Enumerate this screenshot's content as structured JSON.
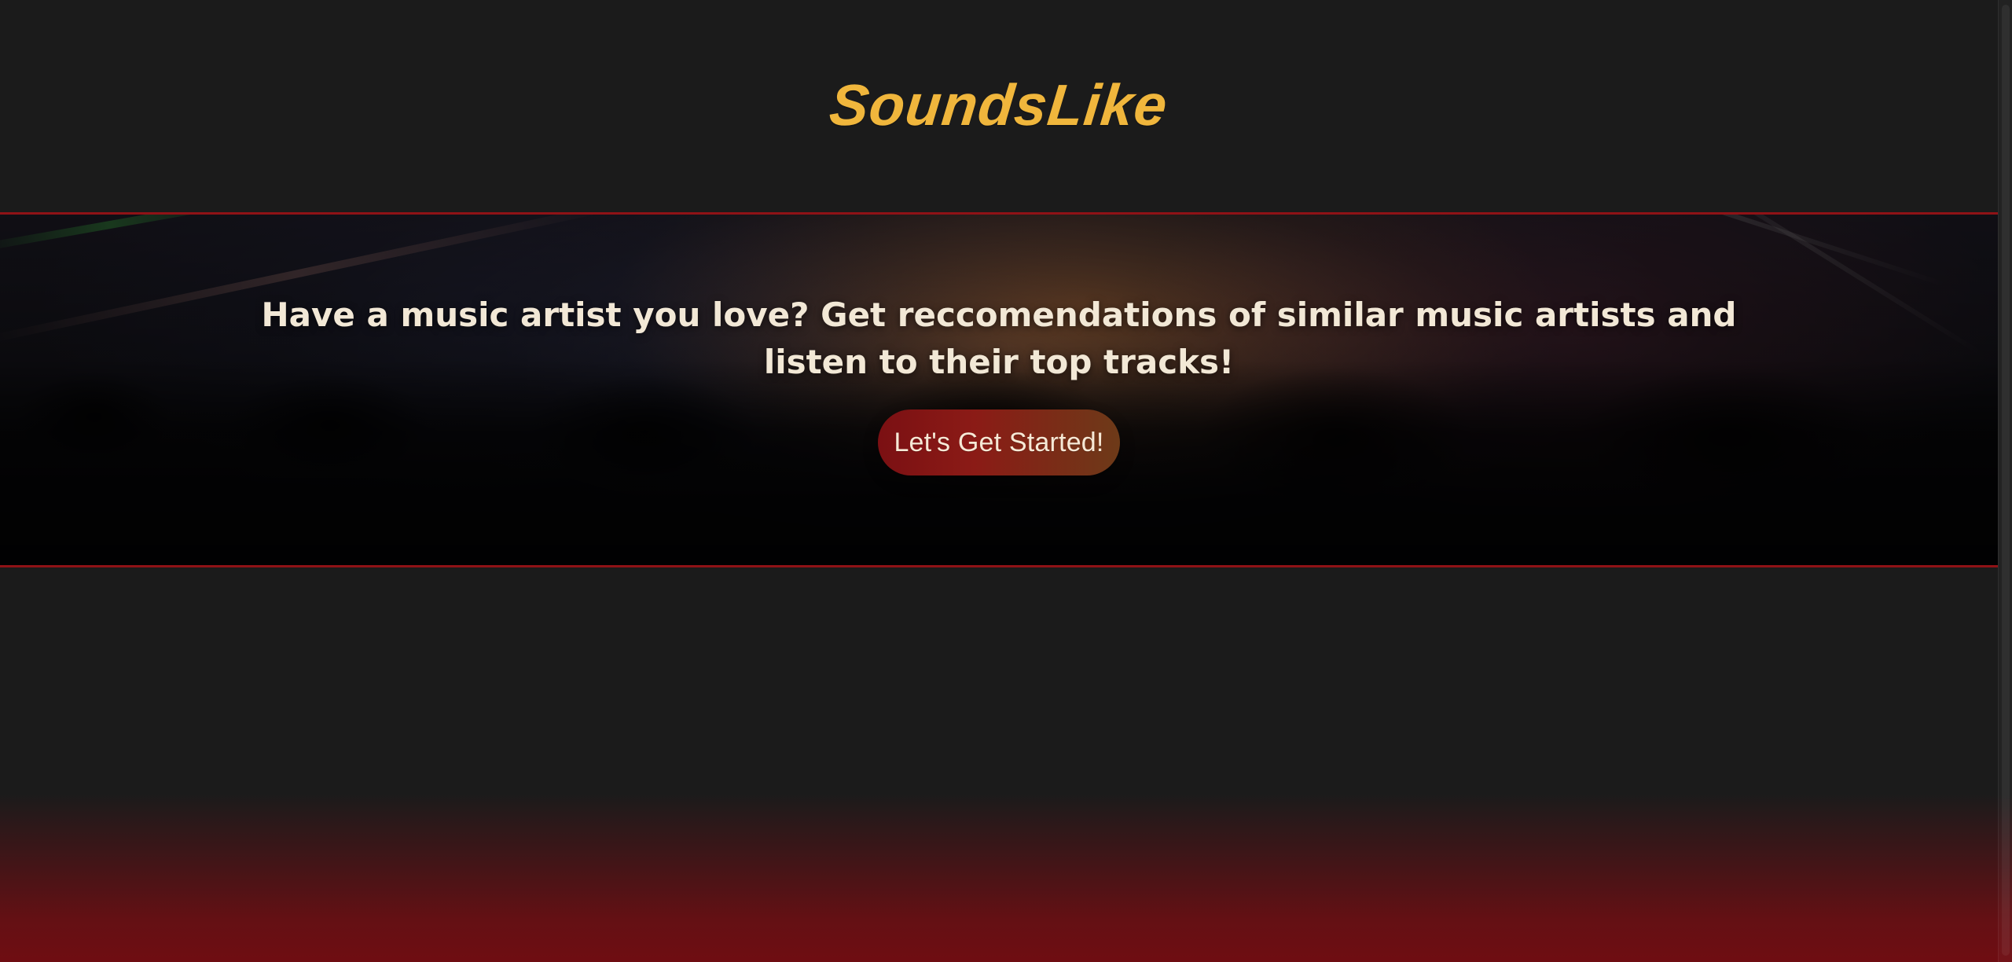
{
  "app": {
    "brand": "SoundsLike"
  },
  "hero": {
    "tagline": "Have a music artist you love? Get reccomendations of similar music artists and listen to their top tracks!",
    "cta_label": "Let's Get Started!"
  },
  "colors": {
    "background": "#1b1b1b",
    "brand": "#f0b63c",
    "border_red": "#8f1216",
    "cta_gradient_start": "#7b1013",
    "cta_gradient_end": "#6d3a18",
    "bottom_red": "#6f0d12"
  }
}
